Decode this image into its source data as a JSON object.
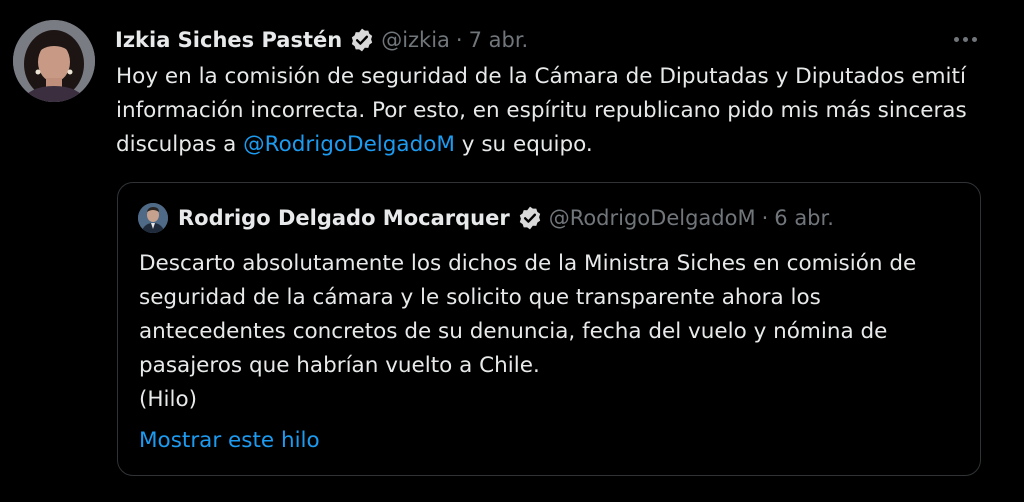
{
  "tweet": {
    "author_name": "Izkia Siches Pastén",
    "handle": "@izkia",
    "separator": "·",
    "date": "7 abr.",
    "text_before": "Hoy en la comisión de seguridad de la Cámara de Diputadas y Diputados emití información incorrecta. Por esto, en espíritu republicano pido mis más sinceras disculpas a ",
    "mention": "@RodrigoDelgadoM",
    "text_after": " y su equipo.",
    "more_icon": "more-horizontal-icon",
    "verified_icon": "verified-badge-icon"
  },
  "quote": {
    "author_name": "Rodrigo Delgado Mocarquer",
    "handle": "@RodrigoDelgadoM",
    "separator": "·",
    "date": "6 abr.",
    "text": "Descarto absolutamente los dichos de la Ministra Siches en comisión de seguridad de la cámara y le solicito que transparente ahora los antecedentes concretos de su denuncia, fecha del vuelo y nómina de pasajeros que habrían vuelto a Chile.",
    "thread_label": "(Hilo)",
    "show_thread_link": "Mostrar este hilo"
  },
  "colors": {
    "background": "#000000",
    "text_primary": "#e7e9ea",
    "text_secondary": "#71767b",
    "accent": "#1d9bf0",
    "border": "#2f3336"
  }
}
